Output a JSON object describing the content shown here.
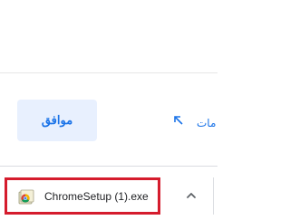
{
  "dialog": {
    "ok_label": "موافق",
    "link_label": "مات"
  },
  "downloads": {
    "items": [
      {
        "file_name": "ChromeSetup (1).exe",
        "icon": "chrome-setup-icon"
      }
    ],
    "menu_icon": "chevron-up-icon"
  },
  "colors": {
    "accent": "#1a73e8",
    "button_bg": "#e8f0fe",
    "highlight_border": "#d51c2d"
  }
}
